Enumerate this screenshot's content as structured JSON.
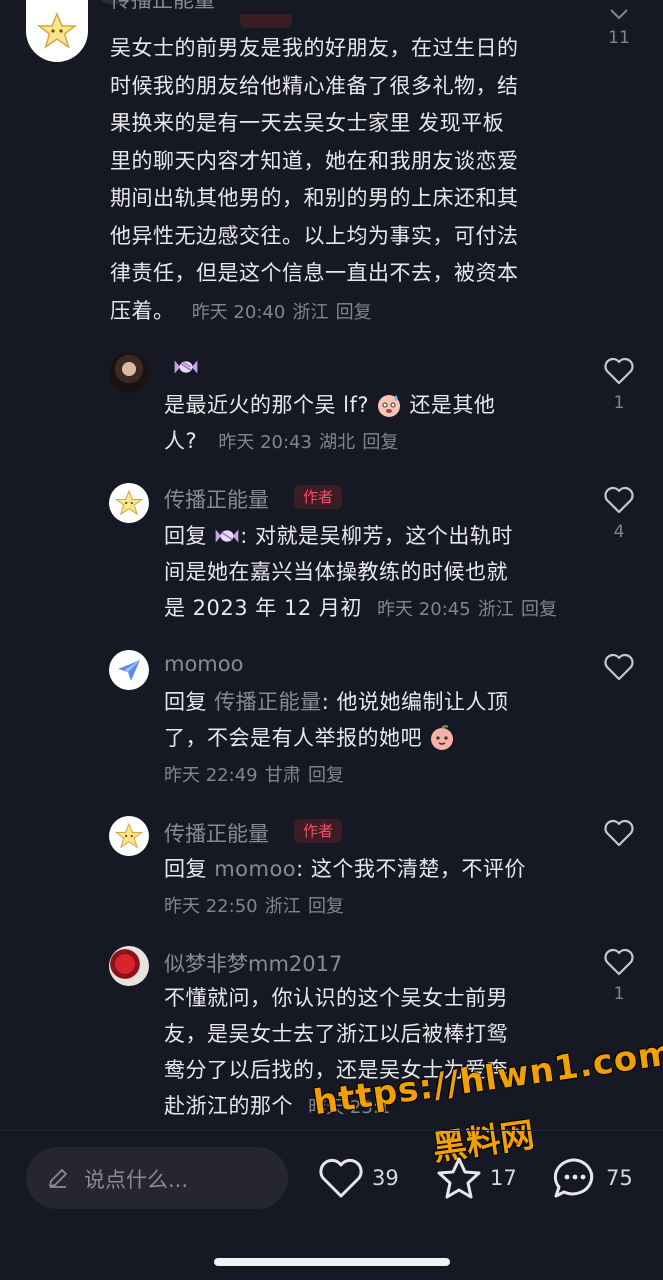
{
  "top_comment": {
    "username_partial": "传播正能量",
    "text": "吴女士的前男友是我的好朋友，在过生日的时候我的朋友给他精心准备了很多礼物，结果换来的是有一天去吴女士家里 发现平板里的聊天内容才知道，她在和我朋友谈恋爱期间出轨其他男的，和别的男的上床还和其他异性无边感交往。以上均为事实，可付法律责任，但是这个信息一直出不去，被资本压着。",
    "lines": [
      "吴女士的前男友是我的好朋友，在过生日的",
      "时候我的朋友给他精心准备了很多礼物，结",
      "果换来的是有一天去吴女士家里 发现平板",
      "里的聊天内容才知道，她在和我朋友谈恋爱",
      "期间出轨其他男的，和别的男的上床还和其",
      "他异性无边感交往。以上均为事实，可付法",
      "律责任，但是这个信息一直出不去，被资本",
      "压着。"
    ],
    "time": "昨天 20:40",
    "location": "浙江",
    "reply_label": "回复",
    "likes": "11"
  },
  "replies": [
    {
      "username_emoji": "candy",
      "lines_a": "是最近火的那个吴 lf?",
      "lines_b": "还是其他",
      "line2": "人?",
      "time": "昨天 20:43",
      "location": "湖北",
      "reply_label": "回复",
      "likes": "1"
    },
    {
      "username": "传播正能量",
      "badge": "作者",
      "prefix": "回复",
      "after_emoji": ": 对就是吴柳芳，这个出轨时",
      "line2": "间是她在嘉兴当体操教练的时候也就",
      "line3": "是 2023 年 12 月初",
      "time": "昨天 20:45",
      "location": "浙江",
      "reply_label": "回复",
      "likes": "4"
    },
    {
      "username": "momoo",
      "prefix": "回复",
      "target": "传播正能量",
      "after": ": 他说她编制让人顶",
      "line2": "了，不会是有人举报的她吧",
      "time": "昨天 22:49",
      "location": "甘肃",
      "reply_label": "回复",
      "likes": ""
    },
    {
      "username": "传播正能量",
      "badge": "作者",
      "prefix": "回复",
      "target": "momoo",
      "after": ": 这个我不清楚，不评价",
      "time": "昨天 22:50",
      "location": "浙江",
      "reply_label": "回复",
      "likes": ""
    },
    {
      "username": "似梦非梦mm2017",
      "line1": "不懂就问，你认识的这个吴女士前男",
      "line2": "友，是吴女士去了浙江以后被棒打鸳",
      "line3": "鸯分了以后找的，还是吴女士为爱奔",
      "line4": "赴浙江的那个",
      "time_partial": "昨天 23:1",
      "likes": "1"
    }
  ],
  "bottom_bar": {
    "input_placeholder": "说点什么...",
    "like_count": "39",
    "favorite_count": "17",
    "comment_count": "75"
  },
  "watermark": {
    "url": "https://hlwn1.com",
    "cn": "黑料网"
  },
  "colors": {
    "background": "#161823",
    "author_badge": "#ff4d66",
    "watermark": "#f2a000"
  }
}
